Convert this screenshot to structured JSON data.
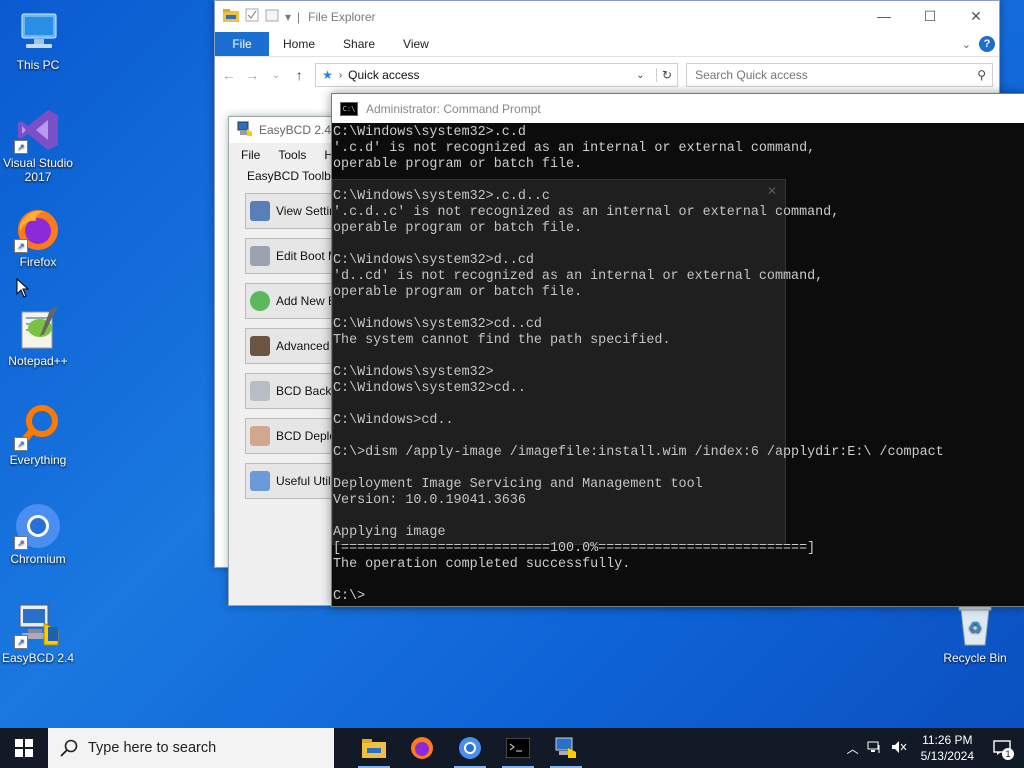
{
  "desktop": {
    "icons": [
      {
        "label": "This PC"
      },
      {
        "label": "Visual Studio 2017"
      },
      {
        "label": "Firefox"
      },
      {
        "label": "Notepad++"
      },
      {
        "label": "Everything"
      },
      {
        "label": "Chromium"
      },
      {
        "label": "EasyBCD 2.4"
      },
      {
        "label": "Recycle Bin"
      }
    ]
  },
  "explorer": {
    "title": "File Explorer",
    "ribbon_tabs": [
      "File",
      "Home",
      "Share",
      "View"
    ],
    "address": "Quick access",
    "search_placeholder": "Search Quick access"
  },
  "easybcd": {
    "title": "EasyBCD 2.4 -",
    "menu": [
      "File",
      "Tools",
      "H"
    ],
    "toolbox_label": "EasyBCD Toolbox",
    "buttons": [
      "View Settin",
      "Edit Boot M",
      "Add New E",
      "Advanced S",
      "BCD Backup",
      "BCD Deploy",
      "Useful Utili"
    ]
  },
  "cmd": {
    "title": "Administrator: Command Prompt",
    "lines": [
      "C:\\Windows\\system32>.c.d",
      "'.c.d' is not recognized as an internal or external command,",
      "operable program or batch file.",
      "",
      "C:\\Windows\\system32>.c.d..c",
      "'.c.d..c' is not recognized as an internal or external command,",
      "operable program or batch file.",
      "",
      "C:\\Windows\\system32>d..cd",
      "'d..cd' is not recognized as an internal or external command,",
      "operable program or batch file.",
      "",
      "C:\\Windows\\system32>cd..cd",
      "The system cannot find the path specified.",
      "",
      "C:\\Windows\\system32>",
      "C:\\Windows\\system32>cd..",
      "",
      "C:\\Windows>cd..",
      "",
      "C:\\>dism /apply-image /imagefile:install.wim /index:6 /applydir:E:\\ /compact",
      "",
      "Deployment Image Servicing and Management tool",
      "Version: 10.0.19041.3636",
      "",
      "Applying image",
      "[==========================100.0%==========================]",
      "The operation completed successfully.",
      "",
      "C:\\>"
    ]
  },
  "taskbar": {
    "search_placeholder": "Type here to search",
    "time": "11:26 PM",
    "date": "5/13/2024",
    "notification_count": "1"
  },
  "colors": {
    "accent": "#1a6fd0",
    "taskbar": "#111a26",
    "console_text": "#cccccc"
  }
}
